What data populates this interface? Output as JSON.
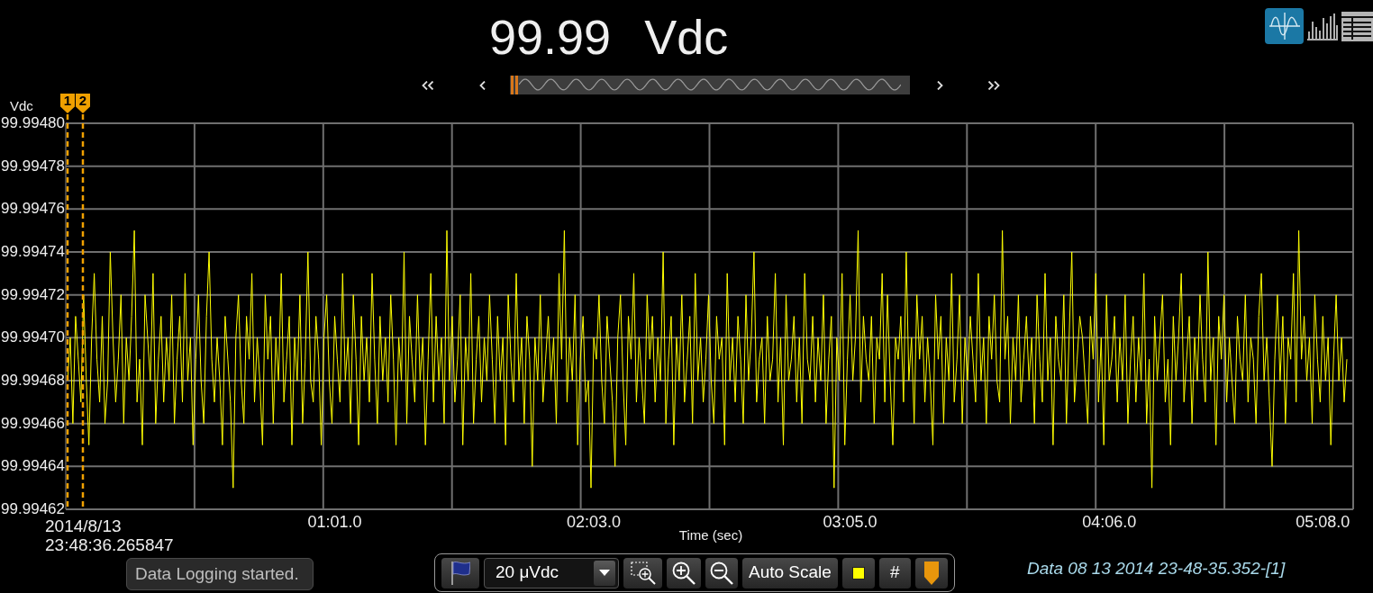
{
  "reading": {
    "value": "99.99",
    "unit": "Vdc"
  },
  "view_buttons": [
    {
      "kind": "trend",
      "selected": true
    },
    {
      "kind": "histogram",
      "selected": false
    },
    {
      "kind": "table",
      "selected": false
    }
  ],
  "chart": {
    "chart_data": {
      "type": "line",
      "xlabel": "Time (sec)",
      "ylabel": "Vdc",
      "grid": true,
      "ylim": [
        99.99462,
        99.9948
      ],
      "yticks": [
        {
          "value": 99.9948,
          "label": "99.99480"
        },
        99.99478,
        99.99476,
        99.99474,
        99.99472,
        {
          "value": 99.9947,
          "label": "99.99470"
        },
        99.99468,
        99.99466,
        99.99464,
        99.99462
      ],
      "categories": [
        null,
        null,
        null,
        null,
        null,
        null,
        null,
        null,
        null,
        null,
        null,
        null,
        null,
        null,
        null,
        null,
        null,
        null,
        null,
        null,
        null,
        null,
        null,
        null,
        null,
        null,
        null,
        null,
        null,
        null,
        null,
        null,
        null,
        null,
        null,
        null,
        null,
        null,
        null,
        null,
        null,
        null,
        null,
        null,
        null,
        null,
        null,
        null,
        null,
        null,
        null,
        null,
        null,
        null,
        null,
        null,
        null,
        null,
        null,
        null,
        null,
        null,
        null,
        null,
        null,
        null,
        null,
        null,
        null,
        null,
        null,
        null,
        null,
        null,
        null,
        null,
        null,
        null,
        null,
        null,
        null,
        null,
        null,
        null,
        null,
        null,
        null,
        null,
        null,
        null,
        null,
        null,
        null,
        null,
        null,
        null,
        null,
        null,
        null,
        null,
        "01:01.0",
        null,
        null,
        null,
        null,
        null,
        null,
        null,
        null,
        null,
        null,
        null,
        null,
        null,
        null,
        null,
        null,
        null,
        null,
        null,
        null,
        null,
        null,
        null,
        null,
        null,
        null,
        null,
        null,
        null,
        null,
        null,
        null,
        null,
        null,
        null,
        null,
        null,
        null,
        null,
        null,
        null,
        null,
        null,
        null,
        null,
        null,
        null,
        null,
        null,
        null,
        null,
        null,
        null,
        null,
        null,
        null,
        null,
        null,
        null,
        null,
        null,
        null,
        null,
        null,
        null,
        null,
        null,
        null,
        null,
        null,
        null,
        null,
        null,
        null,
        null,
        null,
        null,
        null,
        null,
        null,
        null,
        null,
        null,
        null,
        null,
        null,
        null,
        null,
        null,
        null,
        null,
        null,
        null,
        null,
        null,
        null,
        "02:03.0",
        null,
        null,
        null,
        null,
        null,
        null,
        null,
        null,
        null,
        null,
        null,
        null,
        null,
        null,
        null,
        null,
        null,
        null,
        null,
        null,
        null,
        null,
        null,
        null,
        null,
        null,
        null,
        null,
        null,
        null,
        null,
        null,
        null,
        null,
        null,
        null,
        null,
        null,
        null,
        null,
        null,
        null,
        null,
        null,
        null,
        null,
        null,
        null,
        null,
        null,
        null,
        null,
        null,
        null,
        null,
        null,
        null,
        null,
        null,
        null,
        null,
        null,
        null,
        null,
        null,
        null,
        null,
        null,
        null,
        null,
        null,
        null,
        null,
        null,
        null,
        null,
        null,
        null,
        null,
        null,
        null,
        null,
        null,
        null,
        null,
        null,
        null,
        null,
        null,
        null,
        null,
        null,
        null,
        null,
        null,
        "03:05.0",
        null,
        null,
        null,
        null,
        null,
        null,
        null,
        null,
        null,
        null,
        null,
        null,
        null,
        null,
        null,
        null,
        null,
        null,
        null,
        null,
        null,
        null,
        null,
        null,
        null,
        null,
        null,
        null,
        null,
        null,
        null,
        null,
        null,
        null,
        null,
        null,
        null,
        null,
        null,
        null,
        null,
        null,
        null,
        null,
        null,
        null,
        null,
        null,
        null,
        null,
        null,
        null,
        null,
        null,
        null,
        null,
        null,
        null,
        null,
        null,
        null,
        null,
        null,
        null,
        null,
        null,
        null,
        null,
        null,
        null,
        null,
        null,
        null,
        null,
        null,
        null,
        null,
        null,
        null,
        null,
        null,
        null,
        null,
        null,
        null,
        null,
        null,
        null,
        null,
        null,
        null,
        null,
        null,
        null,
        null,
        null,
        "04:06.0",
        null,
        null,
        null,
        null,
        null,
        null,
        null,
        null,
        null,
        null,
        null,
        null,
        null,
        null,
        null,
        null,
        null,
        null,
        null,
        null,
        null,
        null,
        null,
        null,
        null,
        null,
        null,
        null,
        null,
        null,
        null,
        null,
        null,
        null,
        null,
        null,
        null,
        null,
        null,
        null,
        null,
        null,
        null,
        null,
        null,
        null,
        null,
        null,
        null,
        null,
        null,
        null,
        null,
        null,
        null,
        null,
        null,
        null,
        null,
        null,
        null,
        null,
        null,
        null,
        null,
        null,
        null,
        null,
        null,
        null,
        null,
        null,
        null,
        null,
        null,
        null,
        null,
        null,
        null,
        "05:08.0",
        null,
        null,
        null,
        null,
        null,
        null,
        null,
        null,
        null
      ],
      "series": [
        {
          "color": "#ffff00",
          "values": [
            99.99468,
            99.9947,
            99.99466,
            99.99471,
            99.99469,
            99.99467,
            99.99472,
            99.99468,
            99.99465,
            99.9947,
            99.99473,
            99.99469,
            99.99467,
            99.99471,
            99.99466,
            99.99468,
            99.99474,
            99.9947,
            99.99467,
            99.99469,
            99.99472,
            99.99466,
            99.9947,
            99.99468,
            99.99471,
            99.99475,
            99.99467,
            99.99469,
            99.99465,
            99.99472,
            99.9947,
            99.99468,
            99.99473,
            99.99466,
            99.99469,
            99.99471,
            99.99467,
            99.9947,
            99.99468,
            99.99472,
            99.99466,
            99.99469,
            99.99471,
            99.99467,
            99.99473,
            99.99468,
            99.9947,
            99.99465,
            99.99469,
            99.99472,
            99.99468,
            99.99466,
            99.99471,
            99.99474,
            99.99469,
            99.99467,
            99.9947,
            99.99468,
            99.99465,
            99.99471,
            99.99469,
            99.99467,
            99.99463,
            99.9947,
            99.99472,
            99.99468,
            99.99466,
            99.99471,
            99.99469,
            99.99473,
            99.99467,
            99.9947,
            99.99468,
            99.99465,
            99.99472,
            99.99469,
            99.99471,
            99.99466,
            99.9947,
            99.99468,
            99.99473,
            99.99467,
            99.99469,
            99.99471,
            99.99465,
            99.9947,
            99.99468,
            99.99472,
            99.99466,
            99.99469,
            99.99474,
            99.99468,
            99.99467,
            99.99471,
            99.99469,
            99.99465,
            99.9947,
            99.99472,
            99.99468,
            99.99466,
            99.99471,
            99.99469,
            99.99467,
            99.99473,
            99.99468,
            99.9947,
            99.99466,
            99.99472,
            99.99469,
            99.99465,
            99.99471,
            99.99468,
            99.9947,
            99.99467,
            99.99473,
            99.99469,
            99.99466,
            99.99471,
            99.99468,
            99.9947,
            99.99467,
            99.99472,
            99.99469,
            99.99465,
            99.9947,
            99.99468,
            99.99474,
            99.99466,
            99.99471,
            99.99469,
            99.99467,
            99.99472,
            99.99468,
            99.9947,
            99.99465,
            99.99469,
            99.99473,
            99.99467,
            99.99471,
            99.99468,
            99.9947,
            99.99466,
            99.99475,
            99.99468,
            99.99471,
            99.99467,
            99.99469,
            99.99472,
            99.99465,
            99.9947,
            99.99468,
            99.99473,
            99.99466,
            99.99469,
            99.99471,
            99.99467,
            99.9947,
            99.99468,
            99.99472,
            99.99469,
            99.99466,
            99.99471,
            99.99468,
            99.9947,
            99.99465,
            99.99472,
            99.99469,
            99.99467,
            99.99473,
            99.99468,
            99.9947,
            99.99466,
            99.99471,
            99.99469,
            99.99464,
            99.9947,
            99.99468,
            99.99472,
            99.99467,
            99.99469,
            99.99471,
            99.99468,
            99.9947,
            99.99466,
            99.99473,
            99.99469,
            99.99475,
            99.99467,
            99.9947,
            99.99468,
            99.99472,
            99.99465,
            99.99469,
            99.99471,
            99.99467,
            99.99468,
            99.99463,
            99.9947,
            99.99469,
            99.99472,
            99.99468,
            99.99466,
            99.99471,
            99.99469,
            99.99467,
            99.99464,
            99.9947,
            99.99472,
            99.99468,
            99.99465,
            99.99471,
            99.99469,
            99.99473,
            99.99467,
            99.9947,
            99.99468,
            99.99466,
            99.99472,
            99.99469,
            99.99471,
            99.99467,
            99.9947,
            99.99468,
            99.99474,
            99.99466,
            99.99469,
            99.99471,
            99.99465,
            99.9947,
            99.99468,
            99.99472,
            99.99467,
            99.99469,
            99.99471,
            99.99466,
            99.99473,
            99.99468,
            99.9947,
            99.99467,
            99.99469,
            99.99472,
            99.99468,
            99.99466,
            99.99471,
            99.99469,
            99.9947,
            99.99465,
            99.99473,
            99.99468,
            99.9947,
            99.99467,
            99.99471,
            99.99469,
            99.99466,
            99.99472,
            99.99468,
            99.9947,
            99.99474,
            99.99467,
            99.99469,
            99.9947,
            99.99466,
            99.99471,
            99.99468,
            99.99469,
            99.99473,
            99.99467,
            99.9947,
            99.99465,
            99.99472,
            99.99468,
            99.99469,
            99.99471,
            99.99467,
            99.9947,
            99.99466,
            99.99473,
            99.99469,
            99.99468,
            99.99471,
            99.99467,
            99.9947,
            99.99468,
            99.99472,
            99.99466,
            99.99469,
            99.99471,
            99.99463,
            99.9947,
            99.99468,
            99.99473,
            99.99465,
            99.99469,
            99.99472,
            99.99468,
            99.9947,
            99.99475,
            99.99467,
            99.99471,
            99.99469,
            99.99468,
            99.99471,
            99.99466,
            99.9947,
            99.99469,
            99.99473,
            99.99467,
            99.99472,
            99.99468,
            99.99465,
            99.9947,
            99.99469,
            99.99471,
            99.99467,
            99.99474,
            99.99468,
            99.9947,
            99.99466,
            99.99472,
            99.99469,
            99.99471,
            99.99467,
            99.9947,
            99.99468,
            99.99465,
            99.99472,
            99.99469,
            99.99471,
            99.99466,
            99.9947,
            99.99468,
            99.99473,
            99.99467,
            99.99469,
            99.99472,
            99.99466,
            99.9947,
            99.99468,
            99.99471,
            99.99469,
            99.99467,
            99.99473,
            99.99468,
            99.9947,
            99.99466,
            99.99471,
            99.99469,
            99.99472,
            99.99468,
            99.99467,
            99.99475,
            99.99469,
            99.99471,
            99.99466,
            99.9947,
            99.99468,
            99.99472,
            99.99467,
            99.99469,
            99.99471,
            99.99468,
            99.9947,
            99.99466,
            99.99472,
            99.99469,
            99.99467,
            99.99473,
            99.99468,
            99.9947,
            99.99465,
            99.99471,
            99.99469,
            99.99468,
            99.99472,
            99.99466,
            99.9947,
            99.99474,
            99.99467,
            99.99469,
            99.99471,
            99.9947,
            99.99468,
            99.99466,
            99.99471,
            99.99469,
            99.99473,
            99.99467,
            99.9947,
            99.99465,
            99.99472,
            99.99468,
            99.99469,
            99.99471,
            99.99467,
            99.9947,
            99.99468,
            99.99472,
            99.99466,
            99.99469,
            99.99471,
            99.99467,
            99.9947,
            99.99468,
            99.99473,
            99.99466,
            99.99469,
            99.99463,
            99.99471,
            99.99468,
            99.9947,
            99.99472,
            99.99467,
            99.99469,
            99.99465,
            99.99471,
            99.99468,
            99.9947,
            99.99473,
            99.99467,
            99.99469,
            99.99471,
            99.99466,
            99.9947,
            99.99468,
            99.99472,
            99.99469,
            99.99467,
            99.99474,
            99.99468,
            99.9947,
            99.99465,
            99.99471,
            99.99469,
            99.99472,
            99.99467,
            99.9947,
            99.99468,
            99.99466,
            99.99471,
            99.99469,
            99.99468,
            99.99472,
            99.99467,
            99.9947,
            99.99469,
            99.99466,
            99.99471,
            99.99473,
            99.99468,
            99.9947,
            99.99467,
            99.99464,
            99.99469,
            99.99472,
            99.99468,
            99.99471,
            99.99466,
            99.9947,
            99.99469,
            99.99473,
            99.99467,
            99.99475,
            99.99469,
            99.99471,
            99.99468,
            99.9947,
            99.99466,
            99.99472,
            99.99469,
            99.99467,
            99.99471,
            99.99468,
            99.9947,
            99.99465,
            99.99469,
            99.99472,
            99.99468,
            99.9947,
            99.99467,
            99.99469
          ]
        }
      ]
    },
    "start_date": "2014/8/13",
    "start_time": "23:48:36.265847",
    "cursors": [
      {
        "label": "1"
      },
      {
        "label": "2"
      }
    ]
  },
  "status_message": "Data Logging started.",
  "toolbar": [
    {
      "kind": "flag"
    },
    {
      "kind": "dropdown",
      "value": "20 μVdc"
    },
    {
      "kind": "zoom_box"
    },
    {
      "kind": "zoom_in"
    },
    {
      "kind": "zoom_out"
    },
    {
      "kind": "text",
      "label": "Auto Scale"
    },
    {
      "kind": "color"
    },
    {
      "kind": "text",
      "label": "#"
    },
    {
      "kind": "marker"
    }
  ],
  "file_label": "Data 08 13 2014 23-48-35.352-[1]"
}
